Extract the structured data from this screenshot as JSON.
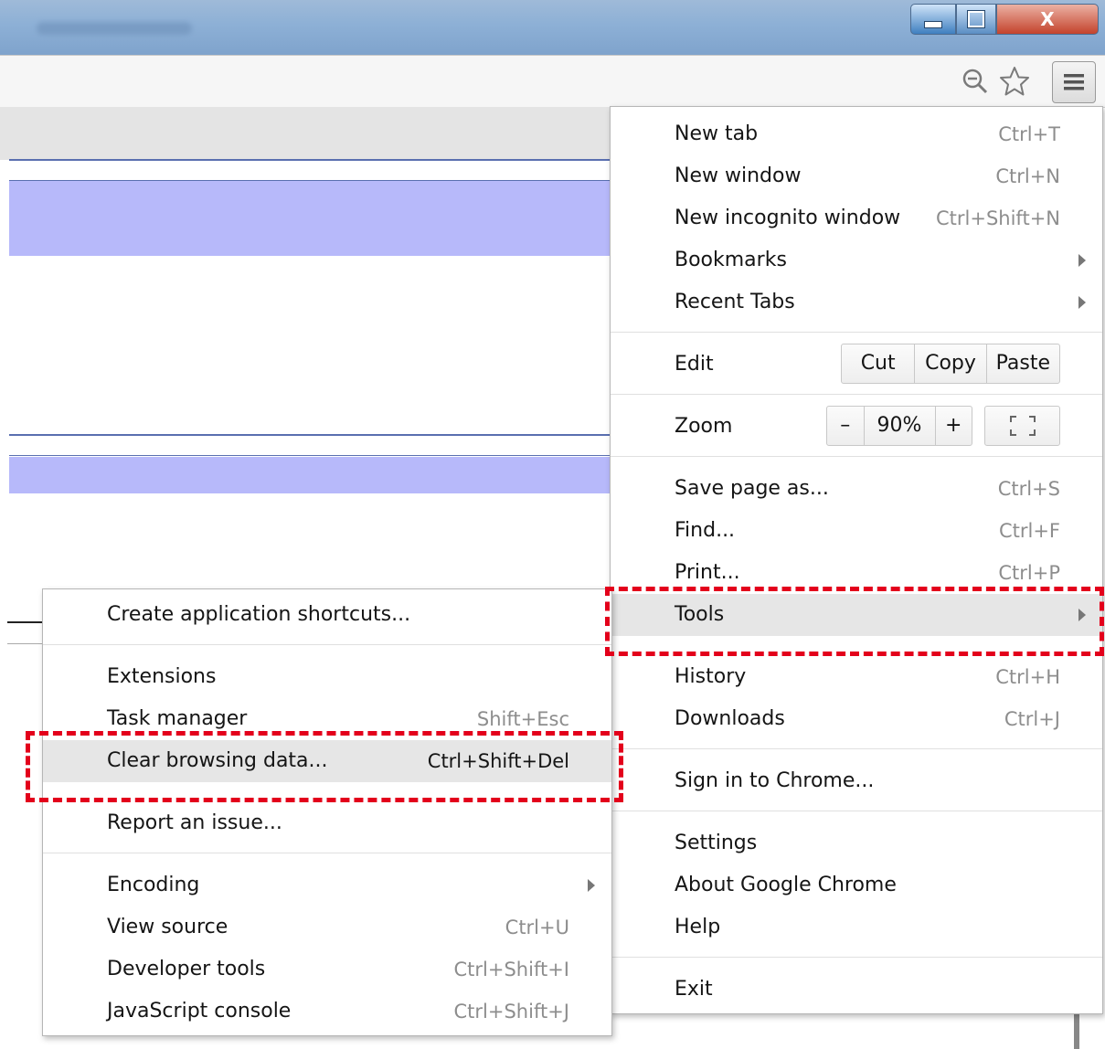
{
  "window": {
    "title": "Microsoft Excel",
    "close_glyph": "X"
  },
  "toolbar": {
    "icons": [
      "zoom-icon",
      "star-icon",
      "menu-icon"
    ]
  },
  "chrome_menu": {
    "items": [
      {
        "label": "New tab",
        "shortcut": "Ctrl+T"
      },
      {
        "label": "New window",
        "shortcut": "Ctrl+N"
      },
      {
        "label": "New incognito window",
        "shortcut": "Ctrl+Shift+N"
      },
      {
        "label": "Bookmarks",
        "shortcut": ""
      },
      {
        "label": "Recent Tabs",
        "shortcut": ""
      }
    ],
    "edit": {
      "label": "Edit",
      "cut": "Cut",
      "copy": "Copy",
      "paste": "Paste"
    },
    "zoom": {
      "label": "Zoom",
      "minus": "–",
      "value": "90%",
      "plus": "+"
    },
    "items2": [
      {
        "label": "Save page as...",
        "shortcut": "Ctrl+S"
      },
      {
        "label": "Find...",
        "shortcut": "Ctrl+F"
      },
      {
        "label": "Print...",
        "shortcut": "Ctrl+P"
      },
      {
        "label": "Tools",
        "shortcut": ""
      },
      {
        "label": "History",
        "shortcut": "Ctrl+H"
      },
      {
        "label": "Downloads",
        "shortcut": "Ctrl+J"
      }
    ],
    "sign_in": "Sign in to Chrome...",
    "items3": [
      {
        "label": "Settings"
      },
      {
        "label": "About Google Chrome"
      },
      {
        "label": "Help"
      }
    ],
    "exit": "Exit"
  },
  "tools_submenu": {
    "create_shortcuts": "Create application shortcuts...",
    "items": [
      {
        "label": "Extensions",
        "shortcut": ""
      },
      {
        "label": "Task manager",
        "shortcut": "Shift+Esc"
      },
      {
        "label": "Clear browsing data...",
        "shortcut": "Ctrl+Shift+Del"
      },
      {
        "label": "Report an issue...",
        "shortcut": ""
      }
    ],
    "items2": [
      {
        "label": "Encoding",
        "shortcut": ""
      },
      {
        "label": "View source",
        "shortcut": "Ctrl+U"
      },
      {
        "label": "Developer tools",
        "shortcut": "Ctrl+Shift+I"
      },
      {
        "label": "JavaScript console",
        "shortcut": "Ctrl+Shift+J"
      }
    ]
  },
  "colors": {
    "highlight_dash": "#e3001b",
    "selected_row": "#b7b9fa"
  }
}
